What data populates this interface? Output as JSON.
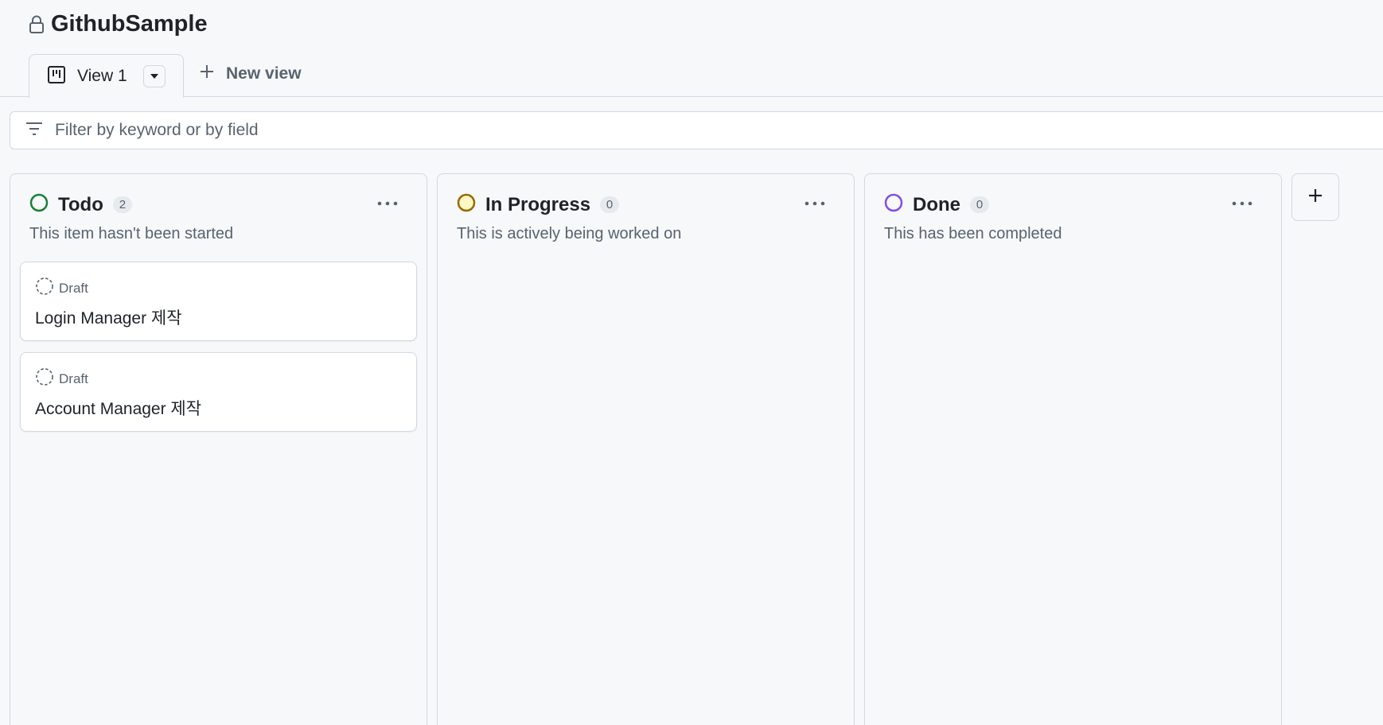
{
  "project": {
    "title": "GithubSample"
  },
  "views": {
    "active": {
      "label": "View 1"
    },
    "new_view_label": "New view"
  },
  "filter": {
    "placeholder": "Filter by keyword or by field"
  },
  "columns": [
    {
      "name": "Todo",
      "count": "2",
      "description": "This item hasn't been started",
      "status_color": "#1a7f37",
      "cards": [
        {
          "status": "Draft",
          "title": "Login Manager 제작"
        },
        {
          "status": "Draft",
          "title": "Account Manager 제작"
        }
      ]
    },
    {
      "name": "In Progress",
      "count": "0",
      "description": "This is actively being worked on",
      "status_color": "#9a6700",
      "cards": []
    },
    {
      "name": "Done",
      "count": "0",
      "description": "This has been completed",
      "status_color": "#8250df",
      "cards": []
    }
  ],
  "icons": {
    "lock": "lock-icon",
    "board": "project-board-icon",
    "caret": "triangle-down-icon",
    "plus": "plus-icon",
    "filter": "filter-icon",
    "kebab": "kebab-horizontal-icon",
    "draft": "issue-draft-icon"
  }
}
